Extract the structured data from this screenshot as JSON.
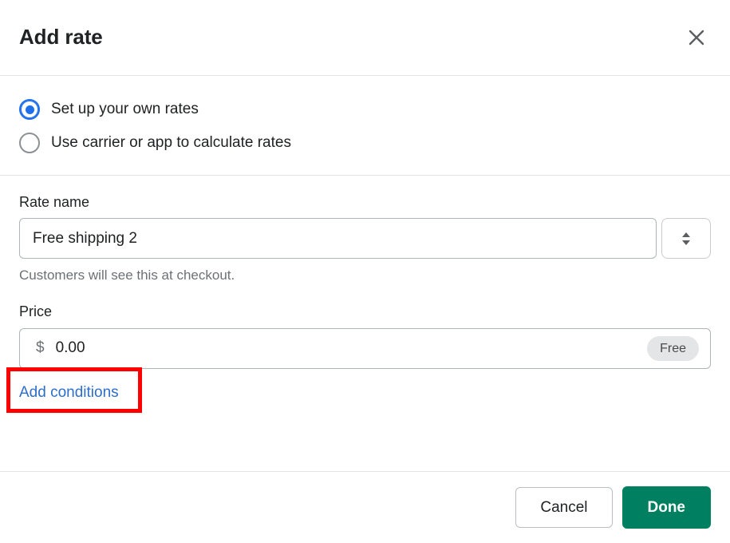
{
  "modal": {
    "title": "Add rate",
    "close_icon": "close-icon"
  },
  "rate_type": {
    "options": [
      {
        "label": "Set up your own rates",
        "selected": true
      },
      {
        "label": "Use carrier or app to calculate rates",
        "selected": false
      }
    ]
  },
  "form": {
    "rate_name": {
      "label": "Rate name",
      "value": "Free shipping 2",
      "placeholder": "Rate name",
      "help_text": "Customers will see this at checkout.",
      "stepper_icon": "chevron-up-down-icon"
    },
    "price": {
      "label": "Price",
      "currency_symbol": "$",
      "value": "0.00",
      "placeholder": "0.00",
      "badge": "Free"
    },
    "add_conditions_label": "Add conditions"
  },
  "footer": {
    "cancel_label": "Cancel",
    "done_label": "Done"
  },
  "annotation": {
    "highlight_color": "#ff0000",
    "target": "Add conditions"
  },
  "colors": {
    "primary_green": "#008060",
    "link_blue": "#2c6ecb",
    "radio_blue": "#1f6feb",
    "badge_gray": "#e4e5e7",
    "divider": "#e1e3e5"
  }
}
